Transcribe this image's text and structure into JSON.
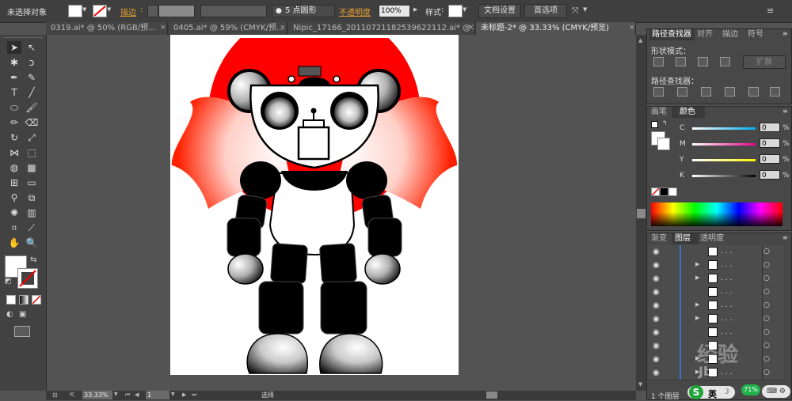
{
  "control_bar": {
    "selection_status": "未选择对象",
    "stroke_label": "描边",
    "brush_label": "5 点圆形",
    "opacity_label": "不透明度",
    "opacity_value": "100%",
    "style_label": "样式",
    "doc_setup_button": "文档设置",
    "preferences_button": "首选项"
  },
  "tabs": [
    {
      "label": "0319.ai* @ 50% (RGB/预...",
      "close": "×"
    },
    {
      "label": "0405.ai* @ 59% (CMYK/预...",
      "close": "×"
    },
    {
      "label": "Nipic_17166_20110721182539622112.ai* @ 2...",
      "close": "×"
    },
    {
      "label": "未标题-2* @ 33.33% (CMYK/预览)",
      "close": "×"
    }
  ],
  "pathfinder_panel": {
    "tabs": [
      "路径查找器",
      "对齐",
      "描边",
      "符号"
    ],
    "shape_modes_label": "形状模式：",
    "expand_button": "扩展",
    "pathfinders_label": "路径查找器："
  },
  "color_panel": {
    "tabs": [
      "画笔",
      "颜色"
    ],
    "channels": [
      {
        "name": "C",
        "value": "0",
        "unit": "%"
      },
      {
        "name": "M",
        "value": "0",
        "unit": "%"
      },
      {
        "name": "Y",
        "value": "0",
        "unit": "%"
      },
      {
        "name": "K",
        "value": "0",
        "unit": "%"
      }
    ]
  },
  "layers_panel": {
    "tabs": [
      "渐变",
      "图层",
      "透明度"
    ],
    "row_names": [
      ". . .",
      ". . .",
      ". . .",
      ". . .",
      ". . .",
      ". . .",
      ". . .",
      ". . .",
      ". . .",
      ". . ."
    ],
    "footer": "1 个图层"
  },
  "status_bar": {
    "zoom": "33.33%",
    "page": "1",
    "tool": "选择"
  },
  "overlay": {
    "ime_label": "英",
    "badge": "71%",
    "watermark": "经验",
    "watermark2": "Jb"
  },
  "colors": {
    "accent_red": "#ff0000",
    "panel_bg": "#484848",
    "workspace_bg": "#535353"
  }
}
